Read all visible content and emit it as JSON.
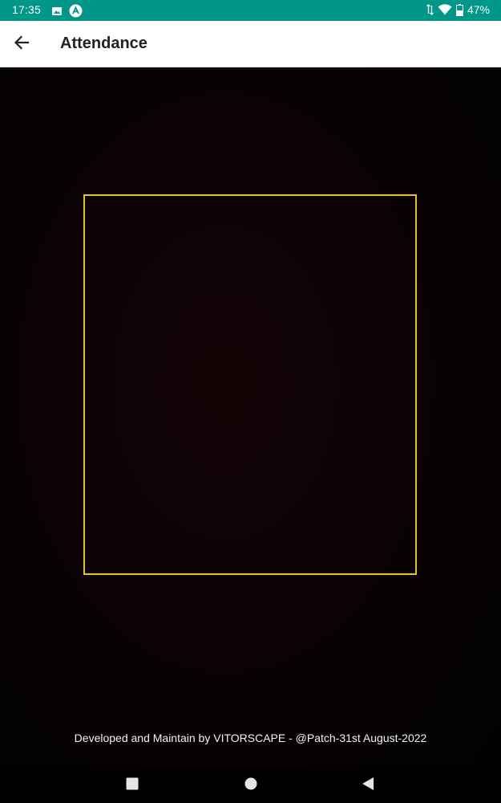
{
  "status_bar": {
    "time": "17:35",
    "battery": "47%",
    "color": "#009688",
    "left_icons": [
      "image-icon",
      "app-notification-icon"
    ],
    "right_icons": [
      "data-arrows-icon",
      "wifi-icon",
      "battery-icon"
    ]
  },
  "app_bar": {
    "title": "Attendance",
    "back_icon": "arrow-back-icon"
  },
  "camera": {
    "frame_color": "#e8bf2a"
  },
  "footer": {
    "credit": "Developed and Maintain by VITORSCAPE - @Patch-31st August-2022"
  },
  "nav_bar": {
    "buttons": [
      "recents",
      "home",
      "back"
    ]
  }
}
